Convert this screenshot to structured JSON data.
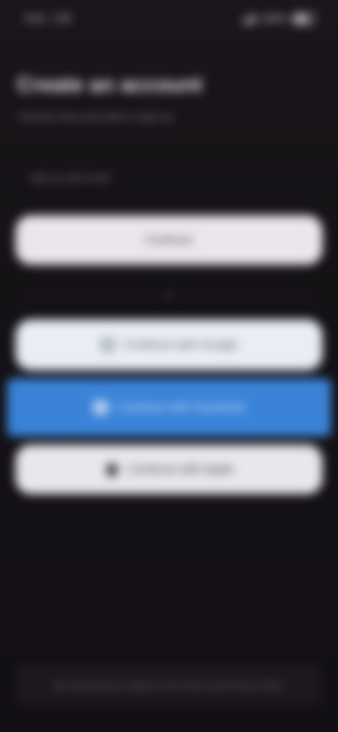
{
  "status_bar": {
    "time": "9:41",
    "network": "LTE",
    "battery_label": "100%"
  },
  "header": {
    "title": "Create an account",
    "subtitle": "Choose how you'd like to sign up"
  },
  "form": {
    "section_label": "Sign up with email",
    "primary_button": "Continue"
  },
  "divider": {
    "text": "or"
  },
  "social": {
    "google_label": "Continue with Google",
    "facebook_label": "Continue with Facebook",
    "apple_label": "Continue with Apple"
  },
  "footer": {
    "text": "By continuing you agree to the Terms and Privacy Policy"
  },
  "icons": {
    "google": "google-icon",
    "facebook": "facebook-icon",
    "apple": "apple-icon"
  },
  "colors": {
    "background": "#141114",
    "facebook_accent": "#3a83d8",
    "button_light": "#eae6ec"
  }
}
